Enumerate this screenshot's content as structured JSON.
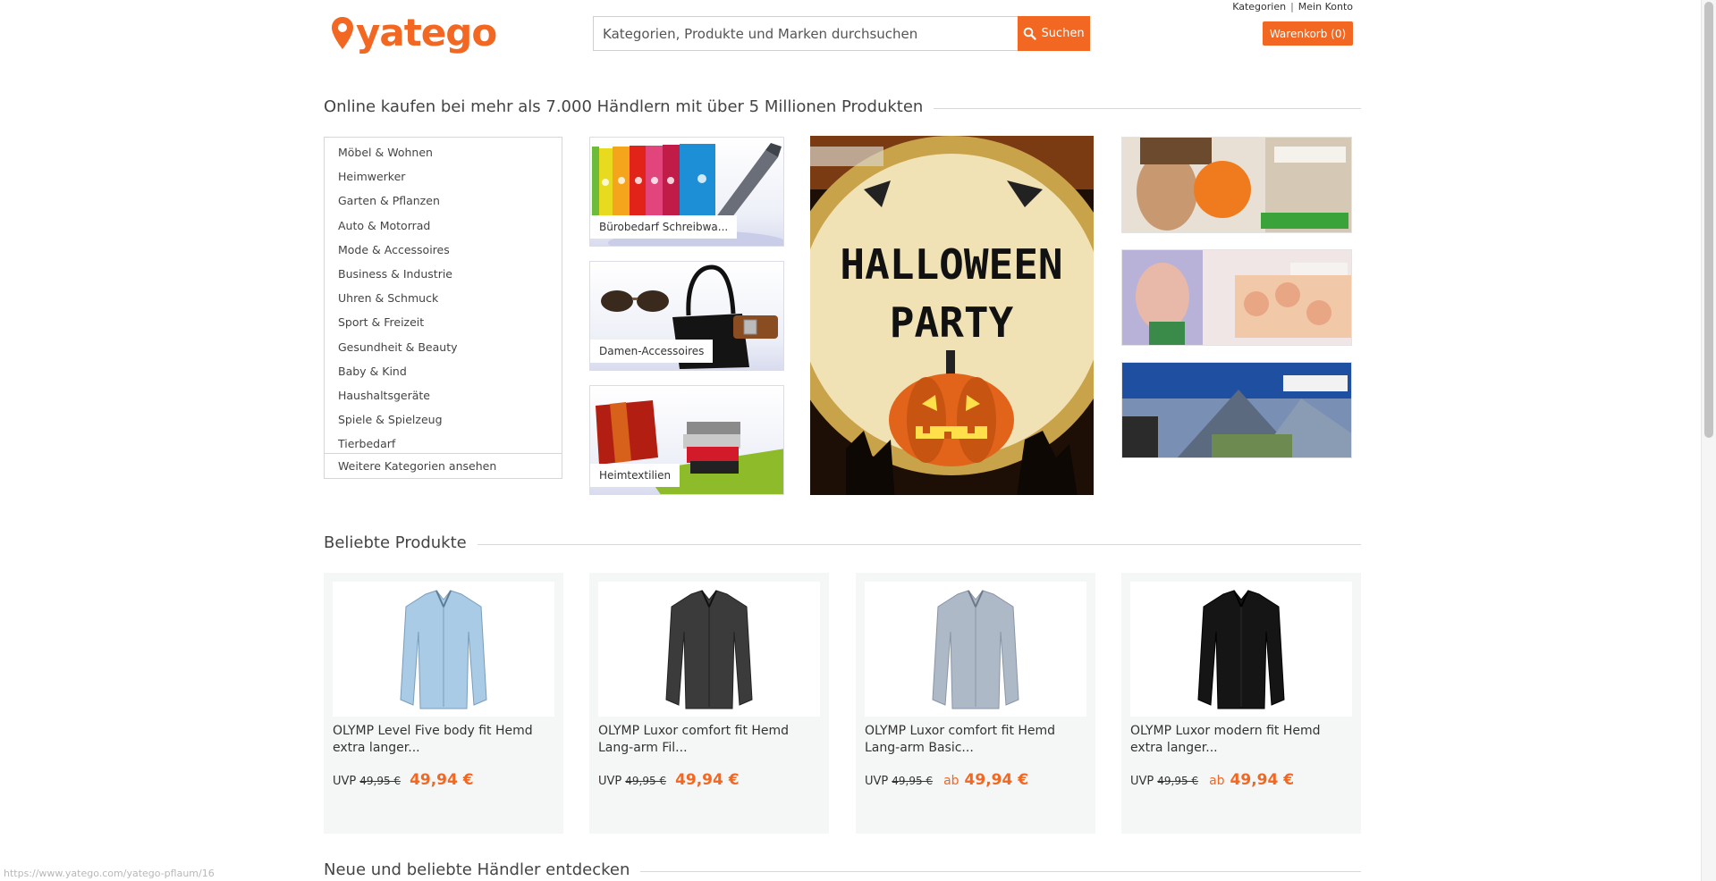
{
  "header": {
    "logo_text": "yatego",
    "search_placeholder": "Kategorien, Produkte und Marken durchsuchen",
    "search_button": "Suchen",
    "toplinks": [
      "Kategorien",
      "Mein Konto"
    ],
    "toplinks_separator": "|",
    "cart_label": "Warenkorb (0)"
  },
  "hero": {
    "heading": "Online kaufen bei mehr als 7.000 Händlern mit über 5 Millionen Produkten"
  },
  "categories": [
    "Möbel & Wohnen",
    "Heimwerker",
    "Garten & Pflanzen",
    "Auto & Motorrad",
    "Mode & Accessoires",
    "Business & Industrie",
    "Uhren & Schmuck",
    "Sport & Freizeit",
    "Gesundheit & Beauty",
    "Baby & Kind",
    "Haushaltsgeräte",
    "Spiele & Spielzeug",
    "Tierbedarf"
  ],
  "categories_more": "Weitere Kategorien ansehen",
  "tiles": [
    {
      "label": "Bürobedarf Schreibwa..."
    },
    {
      "label": "Damen-Accessoires"
    },
    {
      "label": "Heimtextilien"
    }
  ],
  "banner": {
    "text_line1": "HALLOWEEN",
    "text_line2": "PARTY"
  },
  "popular": {
    "heading": "Beliebte Produkte",
    "products": [
      {
        "title": "OLYMP Level Five body fit Hemd extra langer...",
        "uvp_label": "UVP",
        "old_price": "49,95 €",
        "prefix": "",
        "price": "49,94 €",
        "shirt_color": "#a9cbe6"
      },
      {
        "title": "OLYMP Luxor comfort fit Hemd Lang-arm Fil...",
        "uvp_label": "UVP",
        "old_price": "49,95 €",
        "prefix": "",
        "price": "49,94 €",
        "shirt_color": "#3b3b3b"
      },
      {
        "title": "OLYMP Luxor comfort fit Hemd Lang-arm Basic...",
        "uvp_label": "UVP",
        "old_price": "49,95 €",
        "prefix": "ab",
        "price": "49,94 €",
        "shirt_color": "#aeb9c8"
      },
      {
        "title": "OLYMP Luxor modern fit Hemd extra langer...",
        "uvp_label": "UVP",
        "old_price": "49,95 €",
        "prefix": "ab",
        "price": "49,94 €",
        "shirt_color": "#151515"
      }
    ]
  },
  "merchants": {
    "heading": "Neue und beliebte Händler entdecken"
  },
  "status_url": "https://www.yatego.com/yatego-pflaum/16",
  "colors": {
    "brand": "#f26722",
    "text": "#333333",
    "border": "#d6d6d6"
  }
}
